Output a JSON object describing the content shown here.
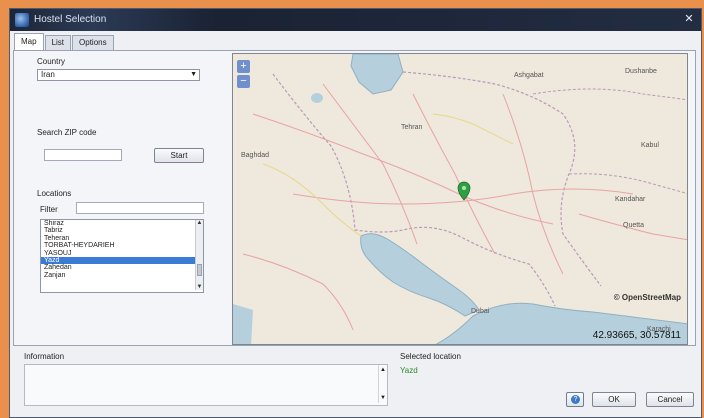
{
  "window": {
    "title": "Hostel Selection"
  },
  "tabs": [
    {
      "label": "Map",
      "active": true
    },
    {
      "label": "List",
      "active": false
    },
    {
      "label": "Options",
      "active": false
    }
  ],
  "country": {
    "label": "Country",
    "value": "Iran"
  },
  "search": {
    "label": "Search ZIP code",
    "value": "",
    "button": "Start"
  },
  "locations": {
    "label": "Locations",
    "filter_label": "Filter",
    "filter_value": "",
    "items": [
      "Shiraz",
      "Tabriz",
      "Teheran",
      "TORBAT-HEYDARIEH",
      "YASOUJ",
      "Yazd",
      "Zahedan",
      "Zanjan"
    ],
    "selected_index": 5
  },
  "map": {
    "attribution": "© OpenStreetMap",
    "coordinates": "42.93665, 30.57811",
    "labels": [
      "Ashgabat",
      "Dushanbe",
      "Kabul",
      "Kandahar",
      "Quetta",
      "Dubai",
      "Karachi",
      "Tehran",
      "Baghdad"
    ],
    "zoom_in": "+",
    "zoom_out": "−"
  },
  "information": {
    "label": "Information",
    "value": ""
  },
  "selected_location": {
    "label": "Selected location",
    "value": "Yazd"
  },
  "buttons": {
    "ok": "OK",
    "cancel": "Cancel",
    "help": "?"
  },
  "colors": {
    "selection": "#3a7bd5",
    "water": "#b6cfdc",
    "land": "#efe8dc",
    "marker": "#2ea043",
    "selected_text": "#2c8a2c"
  }
}
